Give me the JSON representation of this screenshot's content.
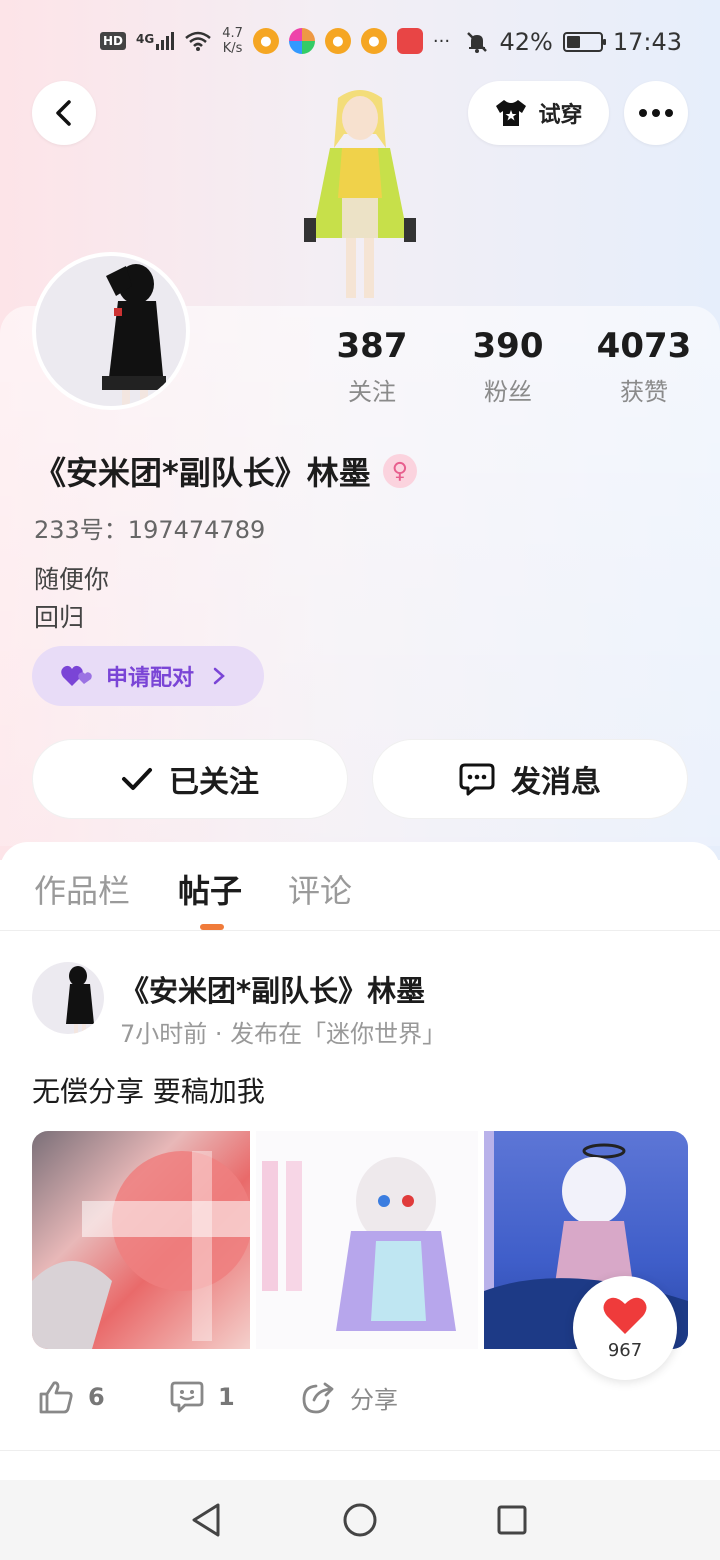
{
  "status_bar": {
    "hd": "HD",
    "network": "4G",
    "speed_value": "4.7",
    "speed_unit": "K/s",
    "more": "···",
    "battery": "42%",
    "battery_level": 0.42,
    "time": "17:43",
    "icons": [
      "hd-icon",
      "signal-icon",
      "wifi-icon",
      "weibo-icon",
      "app-icon",
      "weibo-icon",
      "weibo-icon",
      "shop-icon",
      "mute-icon",
      "battery-icon"
    ]
  },
  "header": {
    "try_on_label": "试穿"
  },
  "profile": {
    "stats": [
      {
        "value": "387",
        "label": "关注"
      },
      {
        "value": "390",
        "label": "粉丝"
      },
      {
        "value": "4073",
        "label": "获赞"
      }
    ],
    "name": "《安米团*副队长》林墨",
    "uid": "233号：197474789",
    "bio_lines": [
      "随便你",
      "回归"
    ],
    "pair_label": "申请配对",
    "follow_label": "已关注",
    "message_label": "发消息"
  },
  "tabs": [
    {
      "label": "作品栏",
      "active": false
    },
    {
      "label": "帖子",
      "active": true
    },
    {
      "label": "评论",
      "active": false
    }
  ],
  "post": {
    "author": "《安米团*副队长》林墨",
    "meta": "7小时前 · 发布在「迷你世界」",
    "text": "无偿分享 要稿加我",
    "like_float_count": "967",
    "likes": "6",
    "comments": "1",
    "share_label": "分享"
  },
  "colors": {
    "accent_orange": "#f07b3a",
    "pair_purple": "#7a45d6",
    "heart_red": "#ef3b3b"
  }
}
